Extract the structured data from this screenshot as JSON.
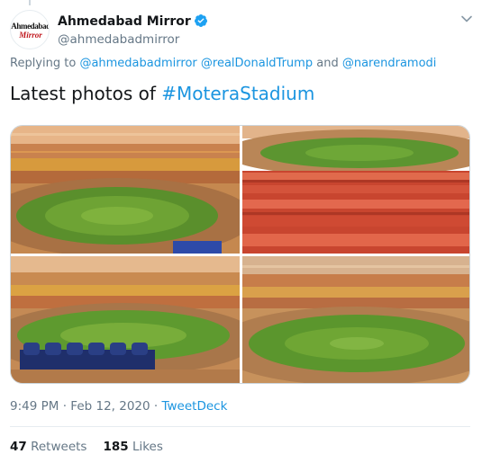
{
  "tweet": {
    "author": {
      "display_name": "Ahmedabad Mirror",
      "handle": "@ahmedabadmirror",
      "verified": true,
      "avatar_text_top": "Ahmedabad",
      "avatar_text_bottom": "Mirror"
    },
    "reply": {
      "prefix": "Replying to",
      "mention_1": "@ahmedabadmirror",
      "mention_2": "@realDonaldTrump",
      "conjunction": "and",
      "mention_3": "@narendramodi"
    },
    "text": {
      "body": "Latest photos of ",
      "hashtag": "#MoteraStadium"
    },
    "photos": [
      {
        "label": "stadium-photo-1"
      },
      {
        "label": "stadium-photo-2"
      },
      {
        "label": "stadium-photo-3"
      },
      {
        "label": "stadium-photo-4"
      }
    ],
    "meta": {
      "time": "9:49 PM",
      "separator": "·",
      "date": "Feb 12, 2020",
      "source": "TweetDeck"
    },
    "stats": {
      "retweets_count": "47",
      "retweets_label": "Retweets",
      "likes_count": "185",
      "likes_label": "Likes"
    },
    "icons": {
      "verified": "verified-badge-icon",
      "menu": "chevron-down-icon"
    },
    "colors": {
      "link": "#1b95e0",
      "secondary_text": "#657786",
      "verified": "#1da1f2"
    }
  }
}
